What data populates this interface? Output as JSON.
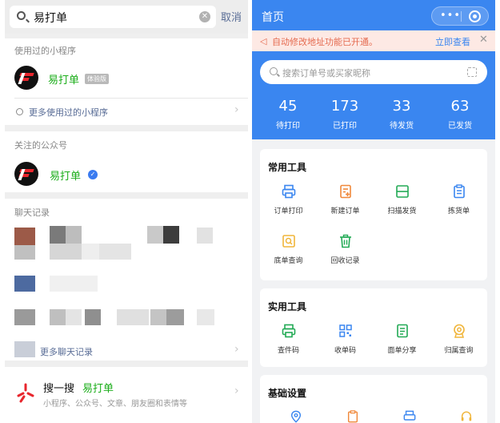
{
  "left": {
    "search": {
      "query": "易打单",
      "cancel": "取消"
    },
    "used_section": {
      "title": "使用过的小程序",
      "item_name": "易打单",
      "item_tag": "体验版",
      "more": "更多使用过的小程序"
    },
    "followed_section": {
      "title": "关注的公众号",
      "item_name": "易打单"
    },
    "chat_section": {
      "title": "聊天记录",
      "more": "更多聊天记录"
    },
    "sousou": {
      "title": "搜一搜",
      "keyword": "易打单",
      "subtitle": "小程序、公众号、文章、朋友圈和表情等"
    }
  },
  "right": {
    "topbar": {
      "title": "首页"
    },
    "notice": {
      "text": "自动修改地址功能已开通。",
      "action": "立即查看",
      "close": "✕"
    },
    "search_placeholder": "搜索订单号或买家昵称",
    "stats": [
      {
        "num": "45",
        "label": "待打印"
      },
      {
        "num": "173",
        "label": "已打印"
      },
      {
        "num": "33",
        "label": "待发货"
      },
      {
        "num": "63",
        "label": "已发货"
      }
    ],
    "common_tools": {
      "title": "常用工具",
      "items": [
        {
          "label": "订单打印",
          "icon": "printer-icon"
        },
        {
          "label": "新建订单",
          "icon": "new-order-icon"
        },
        {
          "label": "扫描发货",
          "icon": "scan-icon"
        },
        {
          "label": "拣货单",
          "icon": "clipboard-icon"
        },
        {
          "label": "底单查询",
          "icon": "search-doc-icon"
        },
        {
          "label": "回收记录",
          "icon": "trash-icon"
        }
      ]
    },
    "practical_tools": {
      "title": "实用工具",
      "items": [
        {
          "label": "查件码",
          "icon": "printer-icon"
        },
        {
          "label": "收单码",
          "icon": "qr-icon"
        },
        {
          "label": "面单分享",
          "icon": "document-icon"
        },
        {
          "label": "归属查询",
          "icon": "location-badge-icon"
        }
      ]
    },
    "basic_settings": {
      "title": "基础设置"
    }
  },
  "colors": {
    "brand_blue": "#3a86f0",
    "wechat_green": "#1aad19",
    "link_blue": "#576b95",
    "notice_red": "#e56a4f"
  }
}
